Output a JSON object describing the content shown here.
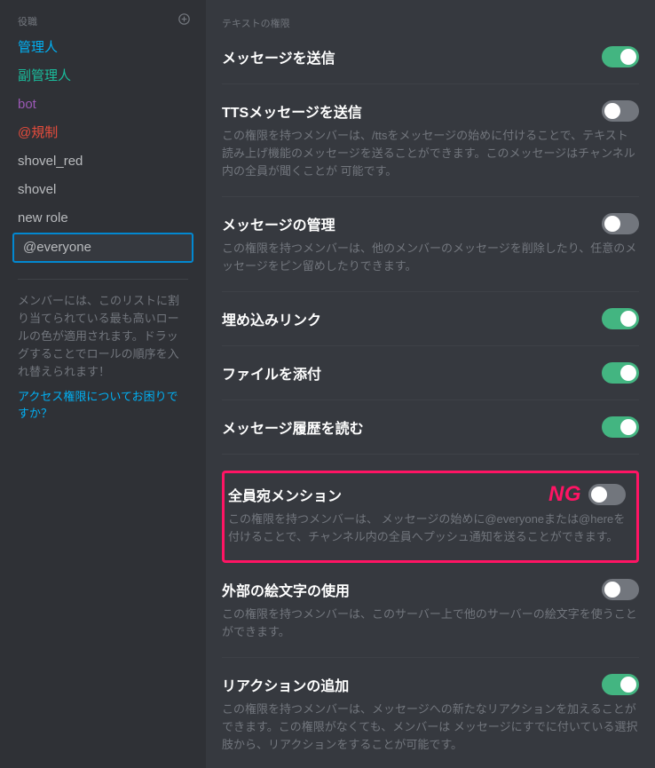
{
  "sidebar": {
    "header": "役職",
    "roles": [
      {
        "label": "管理人",
        "color": "#00b0f4",
        "selected": false
      },
      {
        "label": "副管理人",
        "color": "#1abc9c",
        "selected": false
      },
      {
        "label": "bot",
        "color": "#9b59b6",
        "selected": false
      },
      {
        "label": "@規制",
        "color": "#e74c3c",
        "selected": false
      },
      {
        "label": "shovel_red",
        "color": "#b9bbbe",
        "selected": false
      },
      {
        "label": "shovel",
        "color": "#b9bbbe",
        "selected": false
      },
      {
        "label": "new role",
        "color": "#b9bbbe",
        "selected": false
      },
      {
        "label": "@everyone",
        "color": "#b9bbbe",
        "selected": true
      }
    ],
    "help_text": "メンバーには、このリストに割り当てられている最も高いロールの色が適用されます。ドラッグすることでロールの順序を入れ替えられます！",
    "link_text": "アクセス権限についてお困りですか？"
  },
  "main": {
    "section_header": "テキストの権限",
    "permissions": [
      {
        "title": "メッセージを送信",
        "desc": "",
        "on": true,
        "highlighted": false
      },
      {
        "title": "TTSメッセージを送信",
        "desc": "この権限を持つメンバーは、/ttsをメッセージの始めに付けることで、テキスト読み上げ機能のメッセージを送ることができます。このメッセージはチャンネル内の全員が聞くことが 可能です。",
        "on": false,
        "highlighted": false
      },
      {
        "title": "メッセージの管理",
        "desc": "この権限を持つメンバーは、他のメンバーのメッセージを削除したり、任意のメッセージをピン留めしたりできます。",
        "on": false,
        "highlighted": false
      },
      {
        "title": "埋め込みリンク",
        "desc": "",
        "on": true,
        "highlighted": false
      },
      {
        "title": "ファイルを添付",
        "desc": "",
        "on": true,
        "highlighted": false
      },
      {
        "title": "メッセージ履歴を読む",
        "desc": "",
        "on": true,
        "highlighted": false
      },
      {
        "title": "全員宛メンション",
        "desc": "この権限を持つメンバーは、 メッセージの始めに@everyoneまたは@hereを付けることで、チャンネル内の全員へプッシュ通知を送ることができます。",
        "on": false,
        "highlighted": true,
        "badge": "NG"
      },
      {
        "title": "外部の絵文字の使用",
        "desc": "この権限を持つメンバーは、このサーバー上で他のサーバーの絵文字を使うことができます。",
        "on": false,
        "highlighted": false
      },
      {
        "title": "リアクションの追加",
        "desc": "この権限を持つメンバーは、メッセージへの新たなリアクションを加えることができます。この権限がなくても、メンバーは メッセージにすでに付いている選択肢から、リアクションをすることが可能です。",
        "on": true,
        "highlighted": false
      }
    ]
  }
}
